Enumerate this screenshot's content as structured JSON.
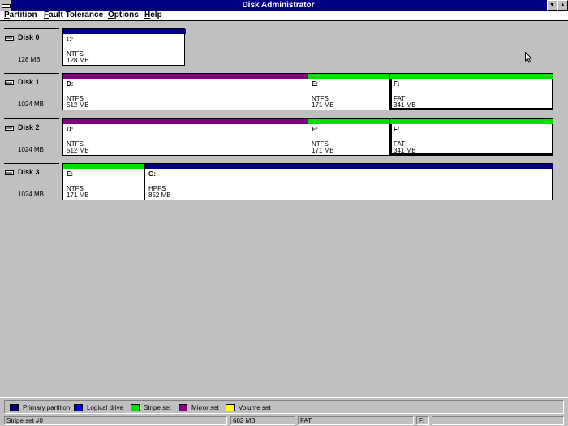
{
  "window": {
    "title": "Disk Administrator",
    "minimize_glyph": "▼",
    "maximize_glyph": "▲"
  },
  "menu": [
    {
      "key": "P",
      "rest": "artition"
    },
    {
      "key": "F",
      "rest": "ault Tolerance"
    },
    {
      "key": "O",
      "rest": "ptions"
    },
    {
      "key": "H",
      "rest": "elp"
    }
  ],
  "colors": {
    "primary_partition": "#000080",
    "logical_drive": "#0000ff",
    "stripe_set": "#00e000",
    "mirror_set": "#800080",
    "volume_set": "#ffff00"
  },
  "disks": [
    {
      "name": "Disk 0",
      "size": "128 MB",
      "partitions": [
        {
          "label": "C:",
          "fs": "NTFS",
          "size": "128 MB",
          "type": "primary_partition"
        }
      ]
    },
    {
      "name": "Disk 1",
      "size": "1024 MB",
      "partitions": [
        {
          "label": "D:",
          "fs": "NTFS",
          "size": "512 MB",
          "type": "mirror_set"
        },
        {
          "label": "E:",
          "fs": "NTFS",
          "size": "171 MB",
          "type": "stripe_set"
        },
        {
          "label": "F:",
          "fs": "FAT",
          "size": "341 MB",
          "type": "stripe_set",
          "selected": true
        }
      ]
    },
    {
      "name": "Disk 2",
      "size": "1024 MB",
      "partitions": [
        {
          "label": "D:",
          "fs": "NTFS",
          "size": "512 MB",
          "type": "mirror_set"
        },
        {
          "label": "E:",
          "fs": "NTFS",
          "size": "171 MB",
          "type": "stripe_set"
        },
        {
          "label": "F:",
          "fs": "FAT",
          "size": "341 MB",
          "type": "stripe_set",
          "selected": true
        }
      ]
    },
    {
      "name": "Disk 3",
      "size": "1024 MB",
      "partitions": [
        {
          "label": "E:",
          "fs": "NTFS",
          "size": "171 MB",
          "type": "stripe_set"
        },
        {
          "label": "G:",
          "fs": "HPFS",
          "size": "852 MB",
          "type": "primary_partition"
        }
      ]
    }
  ],
  "legend": [
    {
      "label": "Primary partition",
      "type": "primary_partition"
    },
    {
      "label": "Logical drive",
      "type": "logical_drive"
    },
    {
      "label": "Stripe set",
      "type": "stripe_set"
    },
    {
      "label": "Mirror set",
      "type": "mirror_set"
    },
    {
      "label": "Volume set",
      "type": "volume_set"
    }
  ],
  "status": {
    "selection": "Stripe set #0",
    "size": "682 MB",
    "filesystem": "FAT",
    "drive": "F:",
    "extra": ""
  }
}
